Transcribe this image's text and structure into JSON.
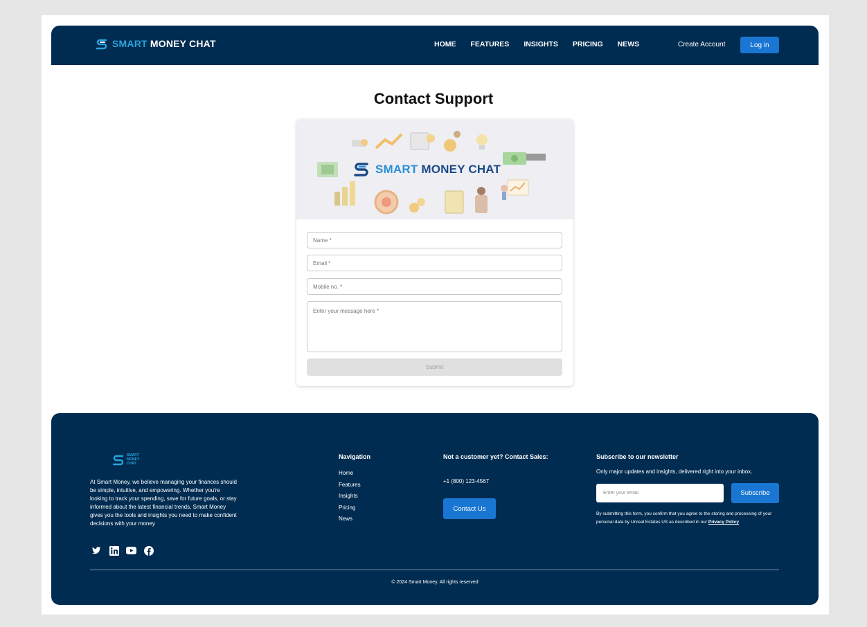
{
  "navbar": {
    "brand_prefix": "SMART",
    "brand_suffix": "MONEY CHAT",
    "links": [
      "HOME",
      "FEATURES",
      "INSIGHTS",
      "PRICING",
      "NEWS"
    ],
    "create_account": "Create Account",
    "login": "Log in"
  },
  "main": {
    "title": "Contact Support",
    "banner_prefix": "SMART",
    "banner_suffix": "MONEY CHAT",
    "form": {
      "name_placeholder": "Name *",
      "email_placeholder": "Email *",
      "mobile_placeholder": "Mobile no. *",
      "message_placeholder": "Enter your message here *",
      "submit": "Submit"
    }
  },
  "footer": {
    "logo_lines": [
      "SMART",
      "MONEY",
      "CHAT"
    ],
    "about": "At Smart Money, we believe managing your finances should be simple, intuitive, and empowering. Whether you're looking to track your spending, save for future goals, or stay informed about the latest financial trends, Smart Money gives you the tools and insights you need to make confident decisions with your money",
    "socials": [
      "twitter-icon",
      "linkedin-icon",
      "youtube-icon",
      "facebook-icon"
    ],
    "navigation": {
      "title": "Navigation",
      "items": [
        "Home",
        "Features",
        "Insights",
        "Pricing",
        "News"
      ]
    },
    "contact": {
      "title": "Not a customer yet? Contact Sales:",
      "phone": "+1 (800) 123-4567",
      "button": "Contact Us"
    },
    "newsletter": {
      "title": "Subscribe to our newsletter",
      "subtitle": "Only major updates and insights, delivered right into your inbox.",
      "email_placeholder": "Enter your email",
      "button": "Subscribe",
      "consent": "By submitting this form, you confirm that you agree to the storing and processing of your personal data by Unreal Estates US as described in our",
      "privacy_link": "Privacy Policy"
    },
    "copyright": "© 2024 Smart Money. All rights reserved"
  },
  "colors": {
    "navy": "#002c51",
    "accent_blue": "#1976d2",
    "brand_cyan": "#29a3dd"
  }
}
